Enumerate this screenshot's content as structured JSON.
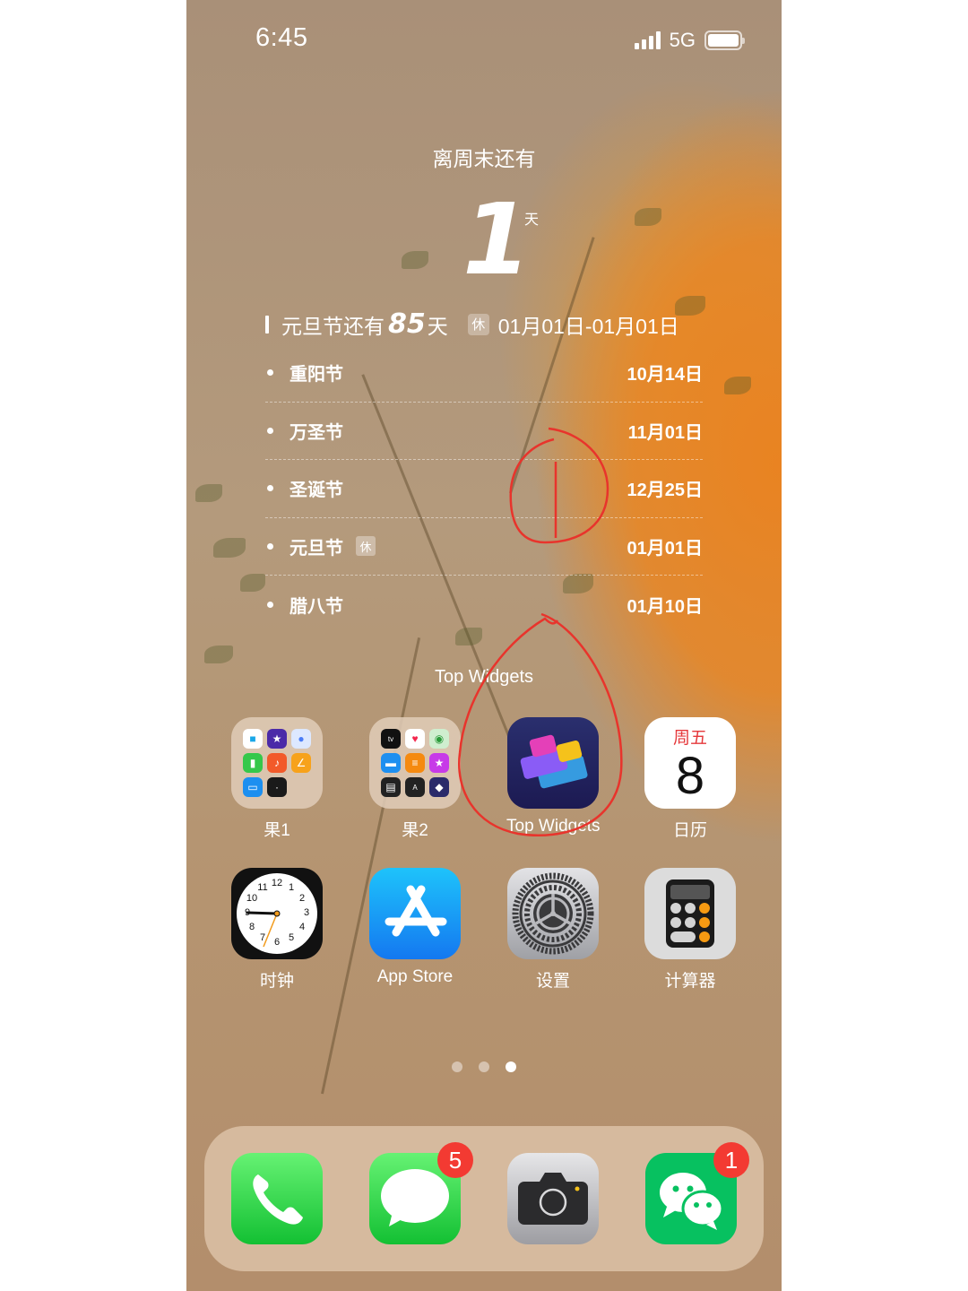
{
  "status_bar": {
    "time": "6:45",
    "network": "5G",
    "signal_bars": 4,
    "battery_level": 1.0
  },
  "widget": {
    "title": "离周末还有",
    "days_value": "1",
    "days_unit": "天",
    "next_holiday_prefix": "元旦节还有",
    "next_holiday_days": "85",
    "next_holiday_unit": "天",
    "rest_badge": "休",
    "next_holiday_range": "01月01日-01月01日",
    "holidays": [
      {
        "name": "重阳节",
        "date": "10月14日",
        "rest": false
      },
      {
        "name": "万圣节",
        "date": "11月01日",
        "rest": false
      },
      {
        "name": "圣诞节",
        "date": "12月25日",
        "rest": false
      },
      {
        "name": "元旦节",
        "date": "01月01日",
        "rest": true,
        "rest_label": "休"
      },
      {
        "name": "腊八节",
        "date": "01月10日",
        "rest": false
      }
    ],
    "source_label": "Top Widgets"
  },
  "apps": {
    "folder1": {
      "label": "果1"
    },
    "folder2": {
      "label": "果2"
    },
    "top_widgets": {
      "label": "Top Widgets"
    },
    "calendar": {
      "label": "日历",
      "weekday": "周五",
      "day": "8"
    },
    "clock": {
      "label": "时钟",
      "numbers": [
        "12",
        "1",
        "2",
        "3",
        "4",
        "5",
        "6",
        "7",
        "8",
        "9",
        "10",
        "11"
      ]
    },
    "app_store": {
      "label": "App Store"
    },
    "settings": {
      "label": "设置"
    },
    "calculator": {
      "label": "计算器"
    }
  },
  "page_indicator": {
    "total": 3,
    "active_index": 2
  },
  "dock": {
    "phone": {
      "badge": null
    },
    "messages": {
      "badge": "5"
    },
    "camera": {
      "badge": null
    },
    "wechat": {
      "badge": "1"
    }
  },
  "colors": {
    "badge_red": "#f33a32",
    "calendar_red": "#e5383b",
    "annotation_red": "#e8342c"
  }
}
